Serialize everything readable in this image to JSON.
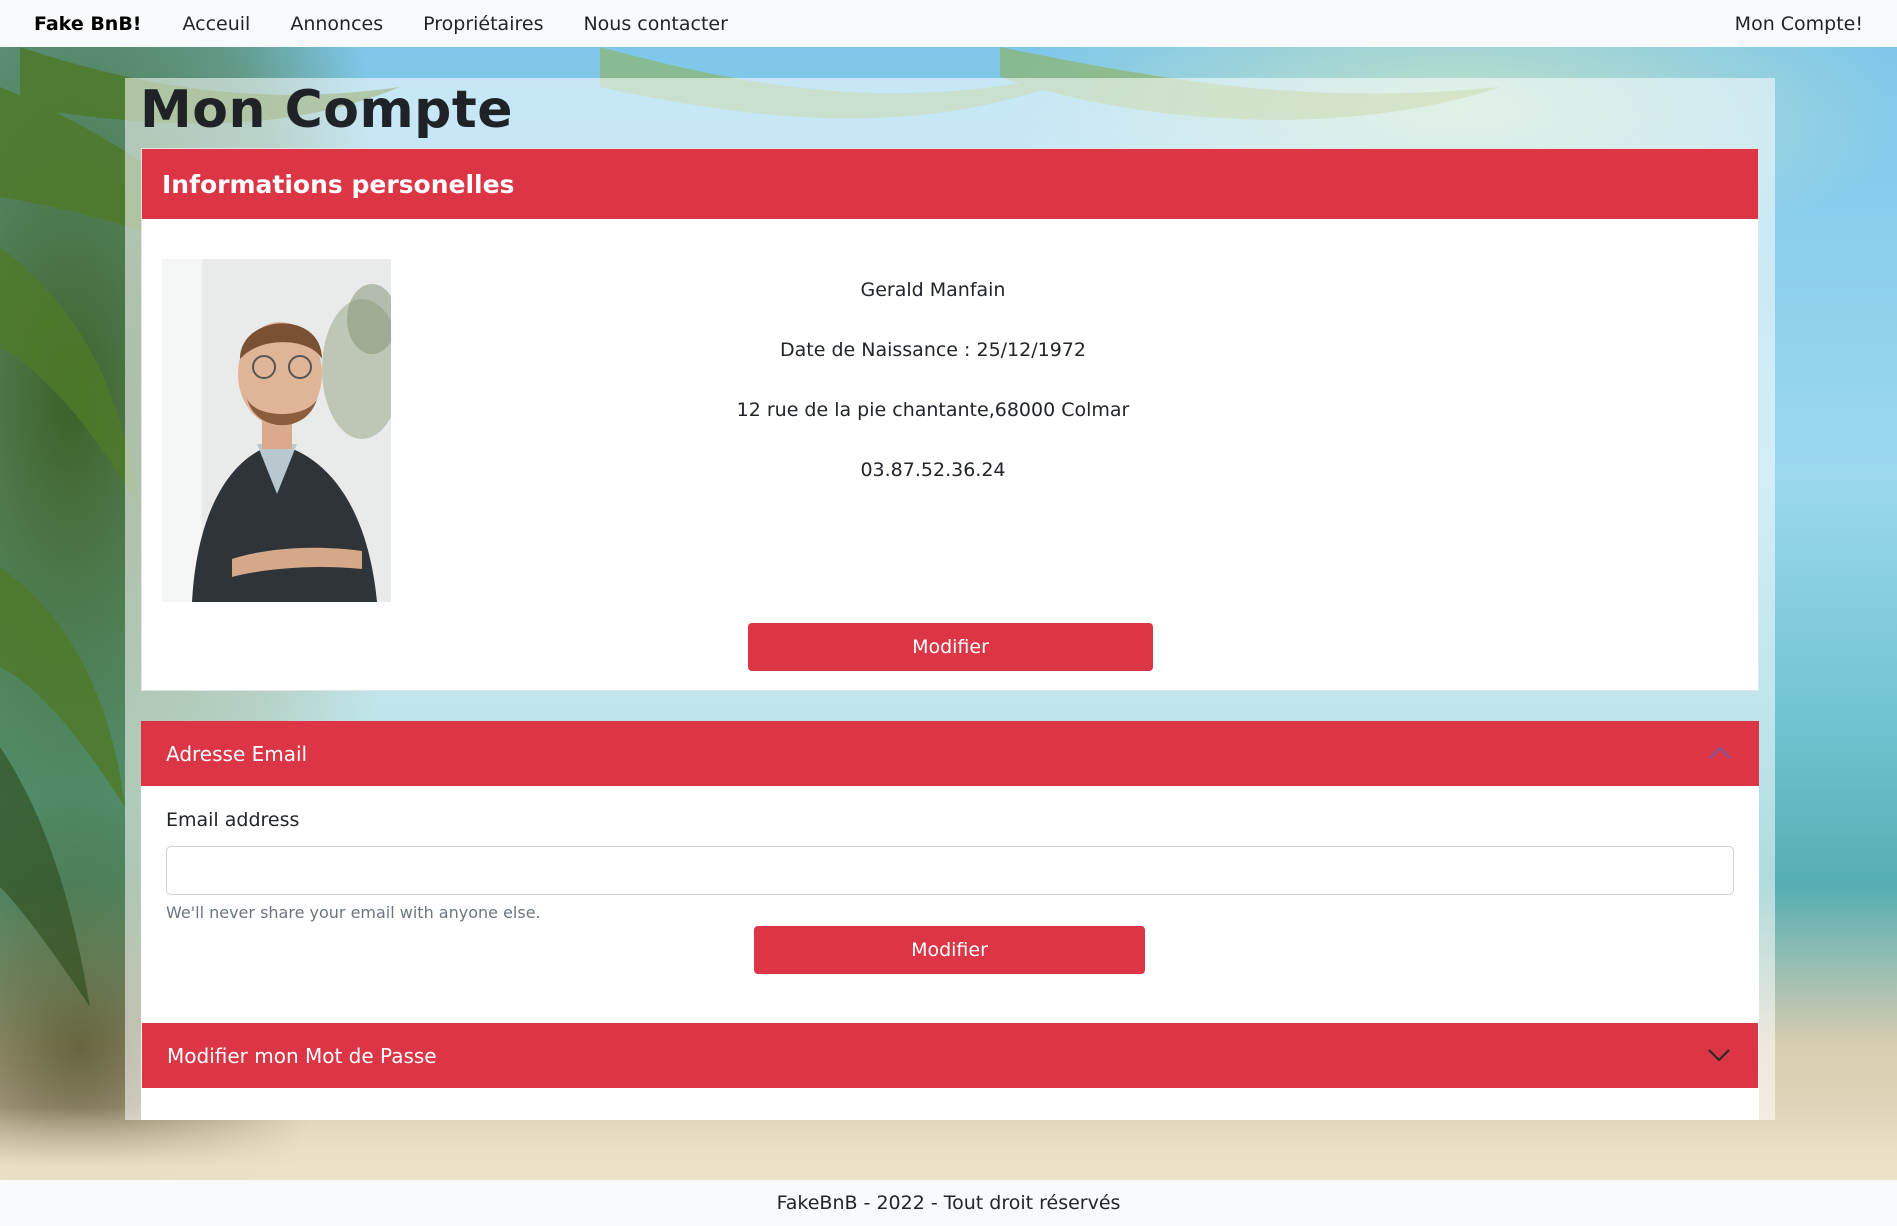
{
  "navbar": {
    "brand": "Fake BnB!",
    "links": [
      "Acceuil",
      "Annonces",
      "Propriétaires",
      "Nous contacter"
    ],
    "account": "Mon Compte!"
  },
  "page": {
    "title": "Mon Compte"
  },
  "personal_info": {
    "header": "Informations personelles",
    "name": "Gerald Manfain",
    "birthdate": "Date de Naissance : 25/12/1972",
    "address": "12 rue de la pie chantante,68000 Colmar",
    "phone": "03.87.52.36.24",
    "edit_button": "Modifier"
  },
  "email_section": {
    "header": "Adresse Email",
    "label": "Email address",
    "value": "",
    "help": "We'll never share your email with anyone else.",
    "button": "Modifier",
    "expanded": true
  },
  "password_section": {
    "header": "Modifier mon Mot de Passe",
    "expanded": false
  },
  "footer": {
    "text": "FakeBnB - 2022 - Tout droit réservés"
  },
  "colors": {
    "accent": "#dc3545",
    "navbar_bg": "#f8f9fa"
  }
}
